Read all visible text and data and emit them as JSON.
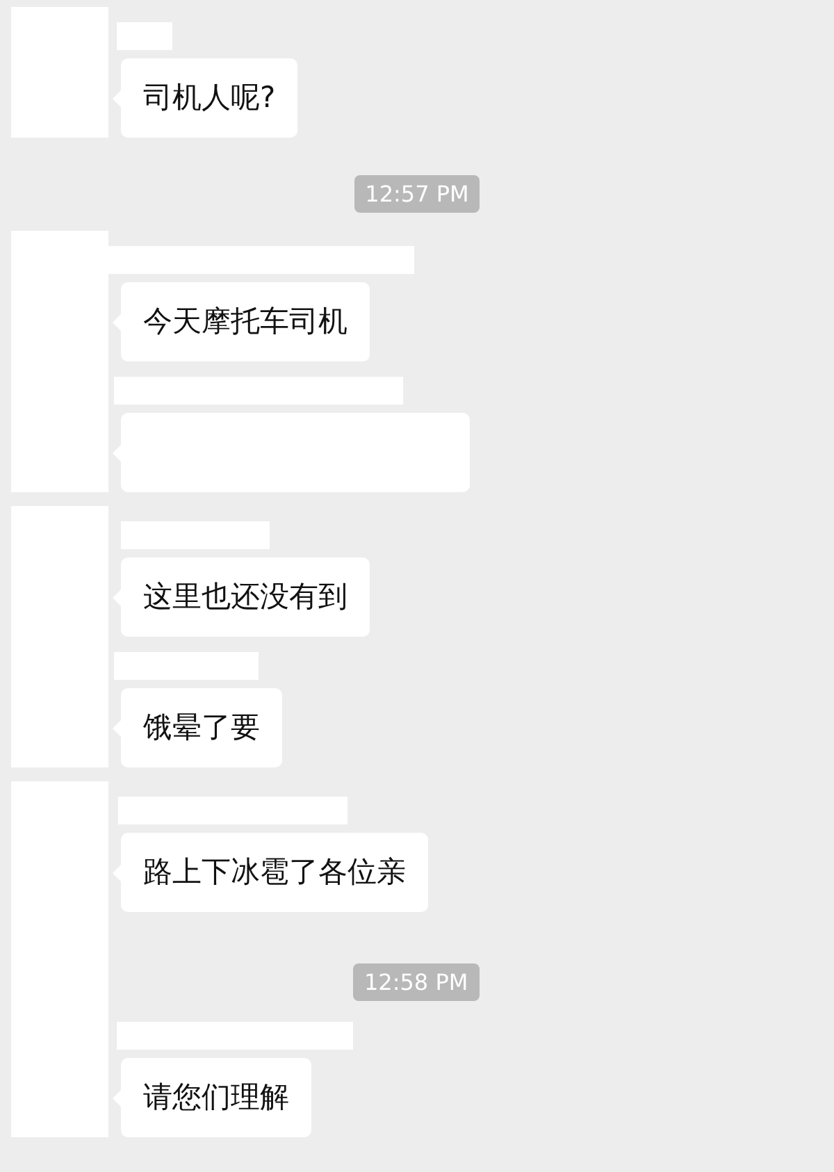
{
  "chat": [
    {
      "kind": "group",
      "items": [
        {
          "kind": "name_bar"
        },
        {
          "kind": "bubble",
          "text": "司机人呢?"
        }
      ]
    },
    {
      "kind": "time",
      "text": "12:57 PM"
    },
    {
      "kind": "group",
      "items": [
        {
          "kind": "name_bar"
        },
        {
          "kind": "bubble",
          "text": "今天摩托车司机"
        },
        {
          "kind": "name_bar"
        },
        {
          "kind": "blank_bubble"
        }
      ]
    },
    {
      "kind": "group",
      "items": [
        {
          "kind": "name_bar"
        },
        {
          "kind": "bubble",
          "text": "这里也还没有到"
        },
        {
          "kind": "name_bar"
        },
        {
          "kind": "bubble",
          "text": "饿晕了要"
        }
      ]
    },
    {
      "kind": "group",
      "items": [
        {
          "kind": "name_bar"
        },
        {
          "kind": "bubble",
          "text": "路上下冰雹了各位亲"
        },
        {
          "kind": "time",
          "text": "12:58 PM"
        },
        {
          "kind": "name_bar"
        },
        {
          "kind": "bubble",
          "text": "请您们理解"
        }
      ]
    }
  ]
}
